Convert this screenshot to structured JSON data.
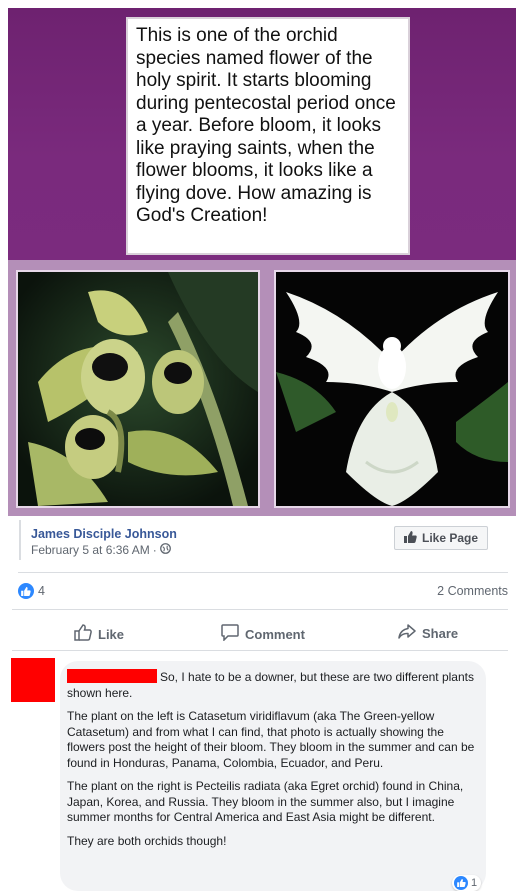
{
  "shared_image": {
    "caption": "This is one of the orchid species named flower of the holy spirit. It starts blooming during pentecostal period once a year. Before bloom, it looks like praying saints, when the flower blooms, it looks like a flying dove. How amazing is God's Creation!",
    "left_photo_subject": "green-yellow catasetum orchid",
    "right_photo_subject": "white egret orchid",
    "colors": {
      "frame_purple": "#7b2a7e",
      "frame_lavender": "#b48fb8"
    }
  },
  "post": {
    "author": "James Disciple Johnson",
    "date": "February 5 at 6:36 AM",
    "privacy_icon": "globe-icon",
    "like_page_label": "Like Page",
    "reaction_count": "4",
    "comments_count": "2 Comments",
    "actions": {
      "like": "Like",
      "comment": "Comment",
      "share": "Share"
    }
  },
  "comment": {
    "intro": "So, I hate to be a downer, but these are two different plants shown here.",
    "paragraphs": [
      "The plant on the left is Catasetum viridiflavum (aka The Green-yellow Catasetum) and from what I can find, that photo is actually showing the flowers post the height of their bloom. They bloom in the summer and can be found in Honduras, Panama, Colombia, Ecuador, and Peru.",
      "The plant on the right is Pecteilis radiata (aka Egret orchid) found in China, Japan, Korea, and Russia. They bloom in the summer also, but I imagine summer months for Central America and East Asia might be different.",
      "They are both orchids though!"
    ],
    "reaction_count": "1",
    "accent": "#2d88ff",
    "redaction_color": "#ff0000"
  }
}
